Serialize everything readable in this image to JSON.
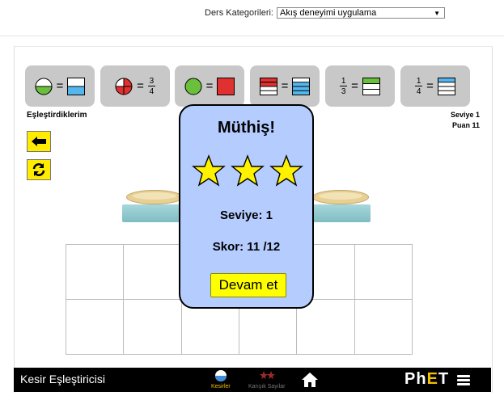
{
  "category": {
    "label": "Ders Kategorileri:",
    "selected": "Akış deneyimi uygulama"
  },
  "cards": [
    {
      "icon": "circle-half-green-icon",
      "eq": "=",
      "result": "rect-half-blue-icon"
    },
    {
      "icon": "circle-three-quarters-red-icon",
      "eq": "=",
      "num": "3",
      "den": "4"
    },
    {
      "icon": "circle-full-green-icon",
      "eq": "=",
      "result": "square-full-red-icon"
    },
    {
      "icon": "rect-half-red-icon",
      "eq": "=",
      "result": "rect-three-quarters-blue-icon"
    },
    {
      "num": "1",
      "den": "3",
      "eq": "=",
      "result": "rect-one-third-green-icon"
    },
    {
      "num": "1",
      "den": "4",
      "eq": "=",
      "result": "rect-one-quarter-blue-icon"
    }
  ],
  "status": {
    "matched_label": "Eşleştirdiklerim",
    "level": "Seviye 1",
    "score": "Puan 11"
  },
  "dialog": {
    "title": "Müthiş!",
    "stars_earned": 3,
    "stars_total": 3,
    "level": "Seviye: 1",
    "score": "Skor: 11 /12",
    "button": "Devam et"
  },
  "navbar": {
    "title": "Kesir Eşleştiricisi",
    "tabs": [
      {
        "label": "Kesirler",
        "icon": "half-circle-icon",
        "active": true
      },
      {
        "label": "Karışık Sayılar",
        "icon": "mixed-numbers-icon",
        "active": false
      }
    ],
    "home_icon": "home-icon",
    "logo": {
      "ph": "Ph",
      "e": "E",
      "t": "T"
    }
  },
  "colors": {
    "accent": "#ffec00",
    "dialog_bg": "#b5ccff",
    "card_bg": "#c8c8c8",
    "active_tab": "#f5c000"
  }
}
